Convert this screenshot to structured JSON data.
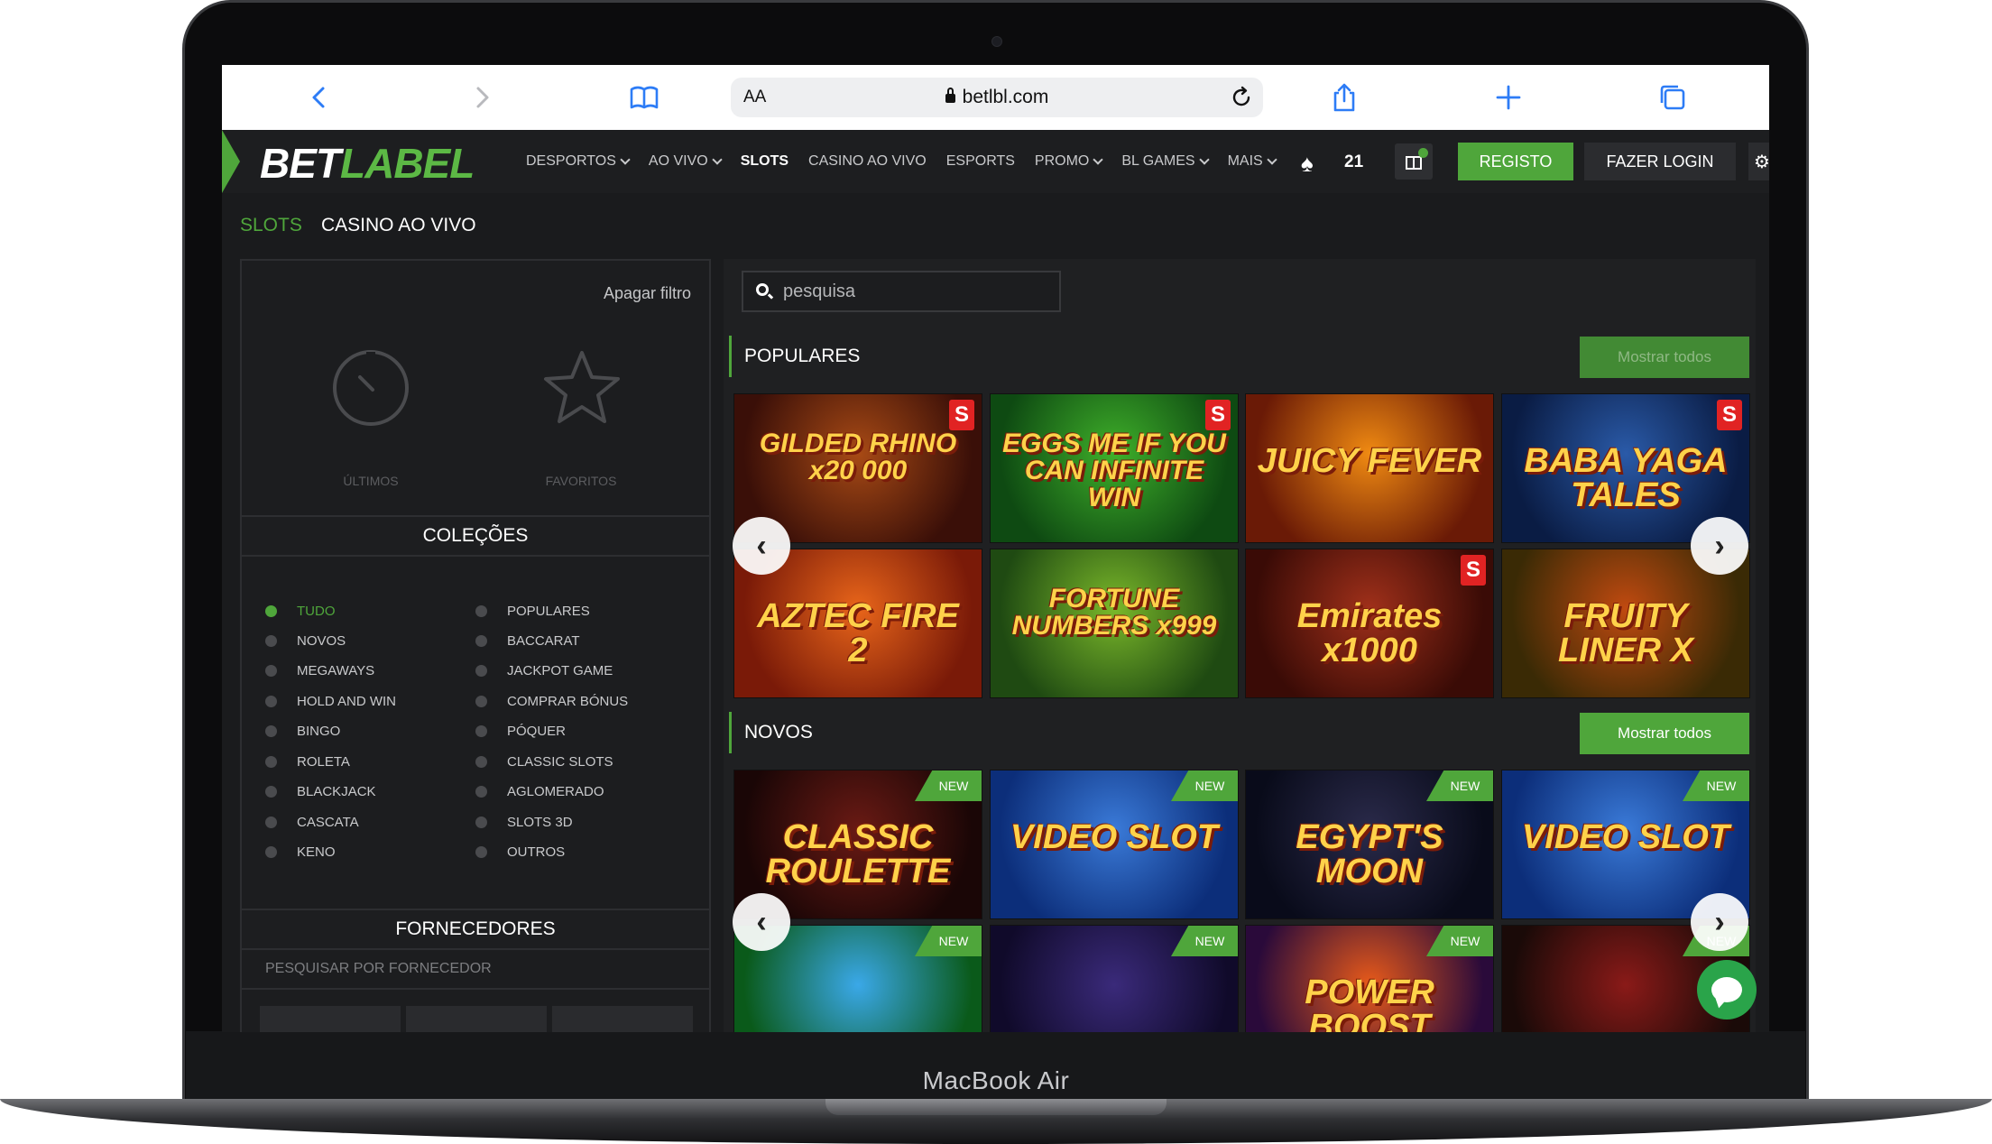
{
  "device_label": "MacBook Air",
  "browser": {
    "aa": "AA",
    "url": "betlbl.com"
  },
  "header": {
    "logo_part1": "BET",
    "logo_part2": "LABEL",
    "nav": [
      {
        "label": "DESPORTOS",
        "dropdown": true
      },
      {
        "label": "AO VIVO",
        "dropdown": true
      },
      {
        "label": "SLOTS",
        "dropdown": false,
        "active": true
      },
      {
        "label": "CASINO AO VIVO",
        "dropdown": false
      },
      {
        "label": "ESPORTS",
        "dropdown": false
      },
      {
        "label": "PROMO",
        "dropdown": true
      },
      {
        "label": "BL GAMES",
        "dropdown": true
      },
      {
        "label": "MAIS",
        "dropdown": true
      }
    ],
    "spade_count": "21",
    "gift_badge": "1",
    "register_label": "REGISTO",
    "login_label": "FAZER LOGIN"
  },
  "subtabs": {
    "slots": "SLOTS",
    "casino": "CASINO AO VIVO"
  },
  "filter": {
    "clear_label": "Apagar filtro",
    "recent_label": "ÚLTIMOS",
    "favorites_label": "FAVORITOS"
  },
  "collections": {
    "title": "COLEÇÕES",
    "left": [
      "TUDO",
      "NOVOS",
      "MEGAWAYS",
      "HOLD AND WIN",
      "BINGO",
      "ROLETA",
      "BLACKJACK",
      "CASCATA",
      "KENO"
    ],
    "right": [
      "POPULARES",
      "BACCARAT",
      "JACKPOT GAME",
      "COMPRAR BÓNUS",
      "PÓQUER",
      "CLASSIC SLOTS",
      "AGLOMERADO",
      "SLOTS 3D",
      "OUTROS"
    ]
  },
  "providers": {
    "title": "FORNECEDORES",
    "search_placeholder": "PESQUISAR POR FORNECEDOR"
  },
  "search": {
    "placeholder": "pesquisa"
  },
  "popular": {
    "title": "POPULARES",
    "show_all": "Mostrar todos",
    "games": [
      {
        "title": "GILDED RHINO x20 000",
        "colors": [
          "#3a0f08",
          "#a84a15"
        ],
        "badge": "S"
      },
      {
        "title": "EGGS ME IF YOU CAN INFINITE WIN",
        "colors": [
          "#0e4a12",
          "#3fb02a"
        ],
        "badge": "S"
      },
      {
        "title": "JUICY FEVER",
        "colors": [
          "#6a1a06",
          "#f08a12"
        ],
        "badge": ""
      },
      {
        "title": "BABA YAGA TALES",
        "colors": [
          "#0a1c44",
          "#2a5aa8"
        ],
        "badge": "S"
      },
      {
        "title": "AZTEC FIRE 2",
        "colors": [
          "#7a1a08",
          "#e8651a"
        ],
        "badge": ""
      },
      {
        "title": "FORTUNE NUMBERS x999",
        "colors": [
          "#1f4a12",
          "#7ab82a"
        ],
        "badge": ""
      },
      {
        "title": "Emirates x1000",
        "colors": [
          "#3a0b06",
          "#a0301a"
        ],
        "badge": "S"
      },
      {
        "title": "FRUITY LINER X",
        "colors": [
          "#3a2a05",
          "#c04a10"
        ],
        "badge": ""
      }
    ]
  },
  "new": {
    "title": "NOVOS",
    "show_all": "Mostrar todos",
    "badge": "NEW",
    "games": [
      {
        "title": "CLASSIC ROULETTE",
        "colors": [
          "#1a0606",
          "#6a1a14"
        ]
      },
      {
        "title": "VIDEO SLOT",
        "colors": [
          "#0c2e7a",
          "#3a7ad8"
        ]
      },
      {
        "title": "EGYPT'S MOON",
        "colors": [
          "#090b1a",
          "#2a2a4a"
        ]
      },
      {
        "title": "VIDEO SLOT",
        "colors": [
          "#0c2e7a",
          "#3a7ad8"
        ]
      },
      {
        "title": "",
        "colors": [
          "#0a5a1a",
          "#3aa8e8"
        ]
      },
      {
        "title": "",
        "colors": [
          "#100a2a",
          "#3a2a7a"
        ]
      },
      {
        "title": "POWER BOOST",
        "colors": [
          "#2a0a3a",
          "#e85a1a"
        ]
      },
      {
        "title": "",
        "colors": [
          "#1a0a08",
          "#8a1a18"
        ]
      }
    ]
  }
}
